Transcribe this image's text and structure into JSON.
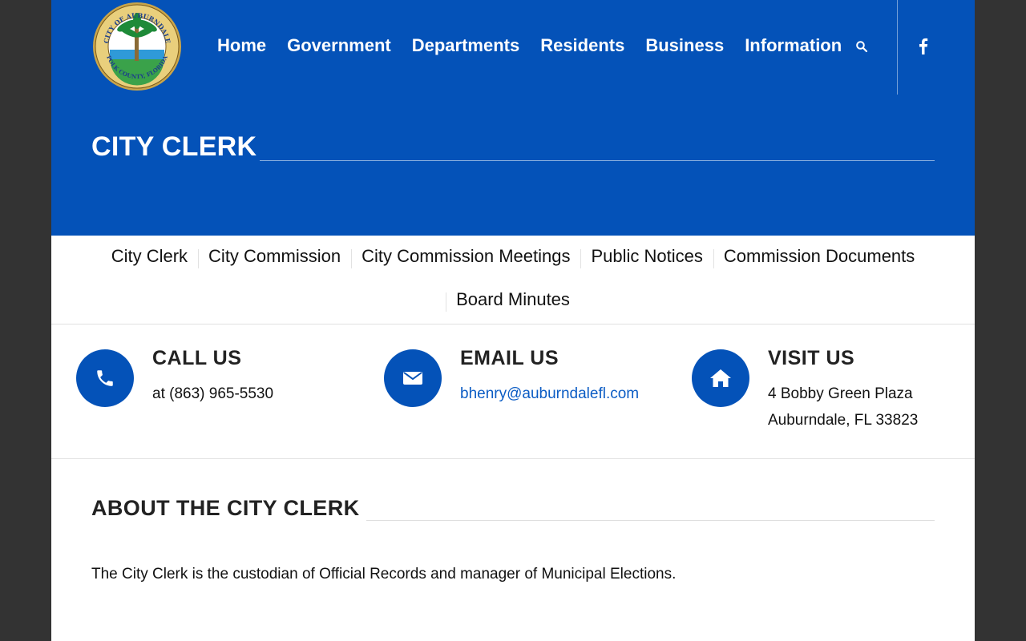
{
  "header": {
    "logo_text_top": "CITY OF AUBURNDALE",
    "logo_text_bottom": "POLK COUNTY, FLORIDA",
    "nav": [
      "Home",
      "Government",
      "Departments",
      "Residents",
      "Business",
      "Information"
    ],
    "search_icon": "search-icon",
    "social_icon": "facebook-icon"
  },
  "page_title": "CITY CLERK",
  "subnav": {
    "row1": [
      "City Clerk",
      "City Commission",
      "City Commission Meetings",
      "Public Notices",
      "Commission Documents"
    ],
    "row2": [
      "Board Minutes"
    ]
  },
  "contacts": [
    {
      "icon": "phone-icon",
      "heading": "CALL US",
      "line1": "at (863) 965-5530"
    },
    {
      "icon": "mail-icon",
      "heading": "EMAIL US",
      "line1": "bhenry@auburndalefl.com"
    },
    {
      "icon": "home-icon",
      "heading": "VISIT US",
      "line1": "4 Bobby Green Plaza",
      "line2": "Auburndale, FL 33823"
    }
  ],
  "about": {
    "title": "ABOUT THE CITY CLERK",
    "text": "The City Clerk is the custodian of Official Records and manager of Municipal Elections."
  },
  "colors": {
    "brand_blue": "#0452b8",
    "link_blue": "#0b5cc4",
    "outer_background": "#333333"
  }
}
